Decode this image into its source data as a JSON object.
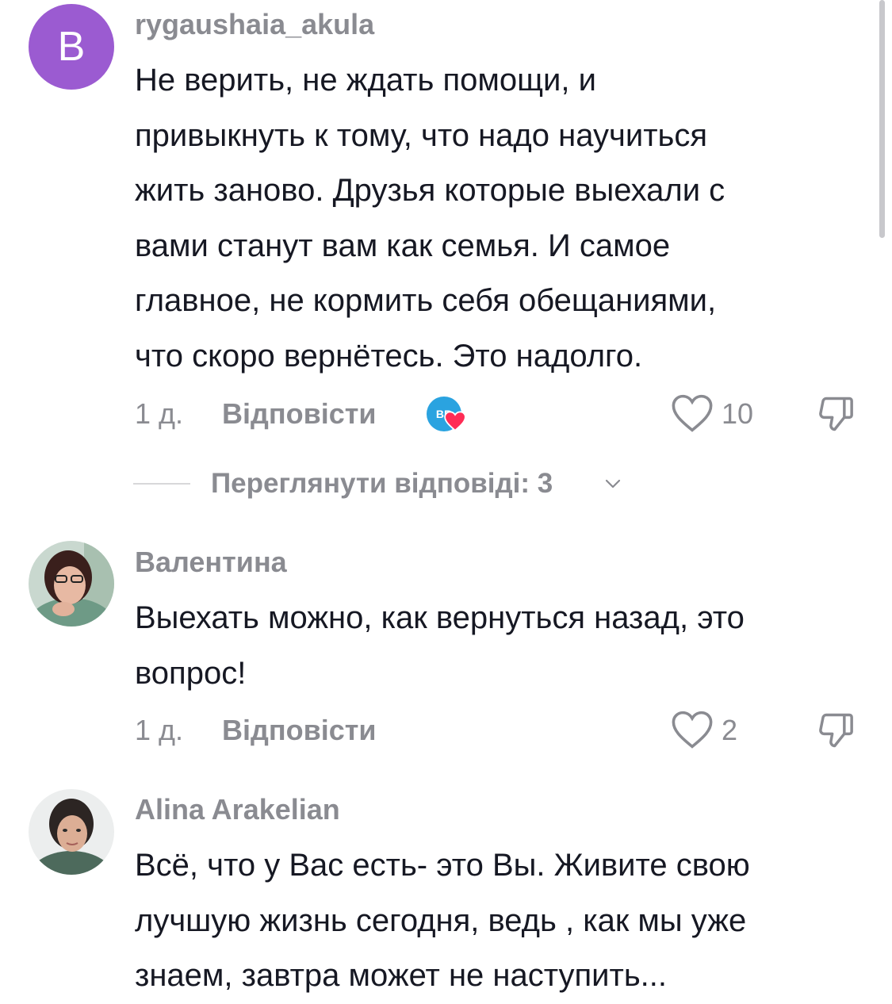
{
  "comments": [
    {
      "avatar_letter": "B",
      "username": "rygaushaia_akula",
      "text_lines": [
        "Не верить, не ждать помощи, и",
        "привыкнуть к тому, что надо научиться",
        "жить заново. Друзья которые выехали с",
        "вами станут вам как семья. И самое",
        "главное, не кормить себя обещаниями,",
        "что скоро вернётесь. Это надолго."
      ],
      "time": "1 д.",
      "reply_label": "Відповісти",
      "badge_text": "BR",
      "likes": "10",
      "view_replies_label": "Переглянути відповіді: 3"
    },
    {
      "username": "Валентина",
      "text_lines": [
        "Выехать можно, как вернуться назад, это",
        "вопрос!"
      ],
      "time": "1 д.",
      "reply_label": "Відповісти",
      "likes": "2"
    },
    {
      "username": "Alina Arakelian",
      "text_lines": [
        "Всё, что у Вас есть- это Вы. Живите свою",
        "лучшую жизнь сегодня, ведь , как мы уже",
        "знаем, завтра может не наступить..."
      ]
    }
  ],
  "colors": {
    "avatar_purple": "#9b5bd1",
    "muted_text": "#8a8b91",
    "main_text": "#161823",
    "creator_badge": "#2aa3e0",
    "heart_red": "#fe2c55"
  },
  "icons": [
    "heart-outline-icon",
    "thumbs-down-icon",
    "chevron-down-icon",
    "heart-icon"
  ]
}
